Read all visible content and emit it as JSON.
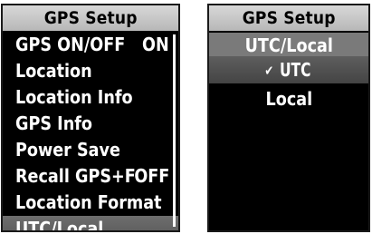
{
  "left_screen": {
    "title": "GPS Setup",
    "items": [
      {
        "label": "GPS ON/OFF",
        "value": "ON"
      },
      {
        "label": "Location",
        "value": ""
      },
      {
        "label": "Location Info",
        "value": ""
      },
      {
        "label": "GPS Info",
        "value": ""
      },
      {
        "label": "Power Save",
        "value": ""
      },
      {
        "label": "Recall GPS+F",
        "value": "OFF"
      },
      {
        "label": "Location Format",
        "value": ""
      },
      {
        "label": "UTC/Local",
        "value": ""
      }
    ],
    "selected_index": 7
  },
  "right_screen": {
    "title": "GPS Setup",
    "subtitle": "UTC/Local",
    "options": [
      {
        "label": "UTC",
        "checked": true
      },
      {
        "label": "Local",
        "checked": false
      }
    ],
    "check_glyph": "✔"
  },
  "colors": {
    "screen_bg": "#000000",
    "titlebar_bg": "#c8c8c8",
    "highlight": "#5a5a5a",
    "text": "#ffffff"
  }
}
